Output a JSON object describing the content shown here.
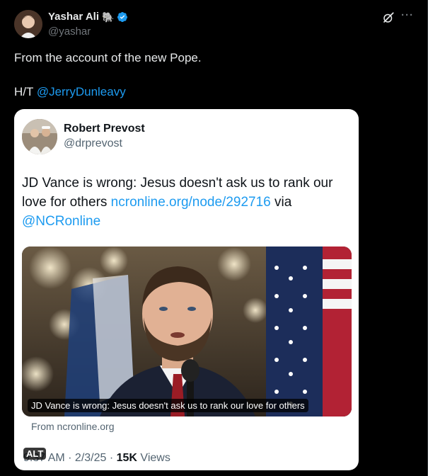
{
  "post": {
    "author": {
      "name": "Yashar Ali",
      "emoji": "🐘",
      "handle": "@yashar"
    },
    "text": "From the account of the new Pope.",
    "ht_prefix": "H/T ",
    "ht_mention": "@JerryDunleavy"
  },
  "quote": {
    "author": {
      "name": "Robert Prevost",
      "handle": "@drprevost"
    },
    "text_main": "JD Vance is wrong: Jesus doesn't ask us to rank our love for others ",
    "link": "ncronline.org/node/292716",
    "via": " via",
    "mention": "@NCRonline",
    "media_caption": "JD Vance is wrong: Jesus doesn't ask us to rank our love for others",
    "media_source": "From ncronline.org",
    "alt_badge": "ALT",
    "time": "9:37 AM",
    "date": "2/3/25",
    "separator": " · ",
    "views_count": "15K",
    "views_label": " Views"
  },
  "colors": {
    "background": "#000000",
    "accent": "#1d9bf0",
    "card_bg": "#ffffff",
    "muted": "#71767b"
  },
  "icons": {
    "verified": "verified-badge-icon",
    "grok": "grok-icon",
    "more": "more-icon"
  }
}
